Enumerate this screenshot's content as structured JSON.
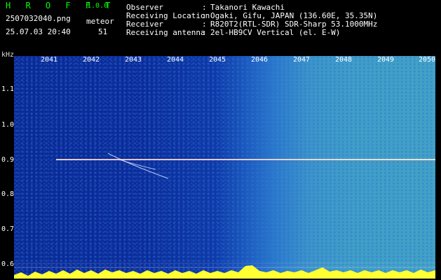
{
  "app": {
    "title": "H R O F F T",
    "version": "1.0.0"
  },
  "file": {
    "name": "2507032040.png",
    "timestamp": "25.07.03 20:40"
  },
  "detection": {
    "mode": "meteor",
    "count": "51"
  },
  "station_info": [
    {
      "key": "Observer",
      "value": "Takanori Kawachi"
    },
    {
      "key": "Receiving Location",
      "value": "Ogaki, Gifu, JAPAN (136.60E, 35.35N)"
    },
    {
      "key": "Receiver",
      "value": "R820T2(RTL-SDR) SDR-Sharp 53.1000MHz"
    },
    {
      "key": "Receiving antenna",
      "value": "2el-HB9CV Vertical (el. E-W)"
    }
  ],
  "axes": {
    "y_unit": "kHz",
    "x_labels": [
      "2041",
      "2042",
      "2043",
      "2044",
      "2045",
      "2046",
      "2047",
      "2048",
      "2049",
      "2050"
    ],
    "y_labels": [
      "1.1",
      "1.0",
      "0.9",
      "0.8",
      "0.7",
      "0.6"
    ],
    "y_values": [
      1.1,
      1.0,
      0.9,
      0.8,
      0.7,
      0.6
    ]
  },
  "colors": {
    "title": "#00ff00",
    "carrier": "#ffffff",
    "background": "#000000"
  }
}
